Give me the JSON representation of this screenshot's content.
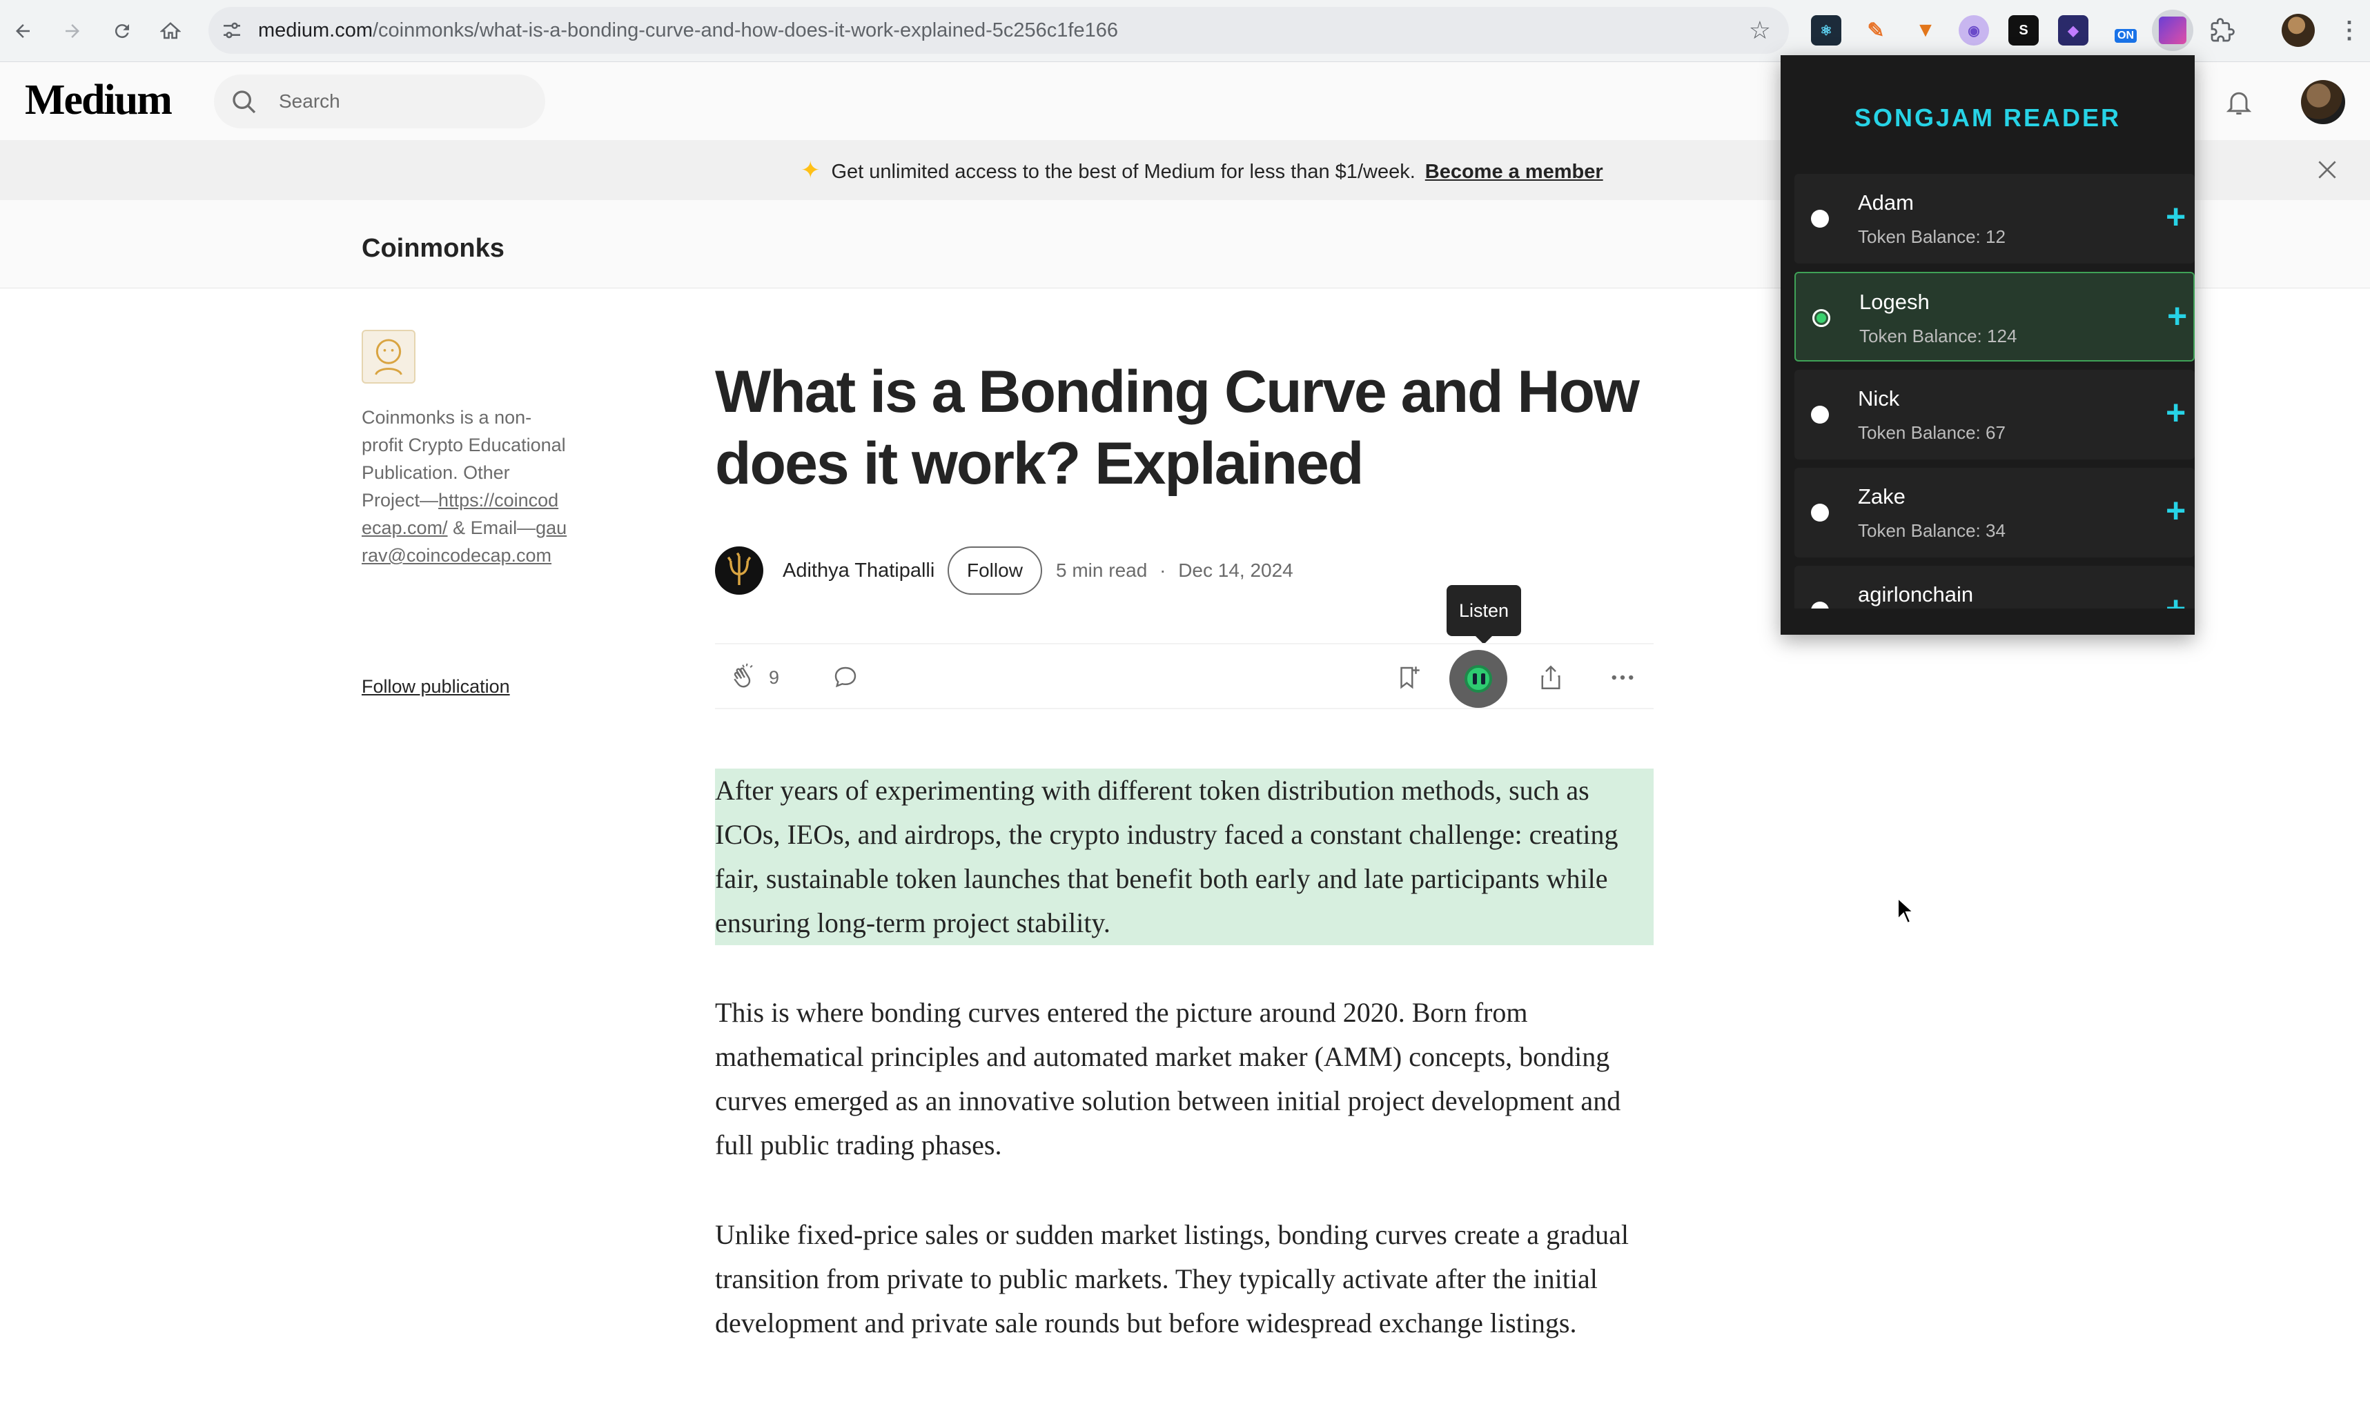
{
  "browser": {
    "url_domain": "medium.com",
    "url_path": "/coinmonks/what-is-a-bonding-curve-and-how-does-it-work-explained-5c256c1fe166",
    "extension_badge": "ON"
  },
  "medium": {
    "logo": "Medium",
    "search_placeholder": "Search"
  },
  "banner": {
    "text": "Get unlimited access to the best of Medium for less than $1/week.",
    "cta": "Become a member"
  },
  "publication": {
    "name": "Coinmonks",
    "description_prefix": "Coinmonks is a non-profit Crypto Educational Publication. Other Project—",
    "project_link": "https://coincodecap.com/",
    "email_label": "& Email—",
    "email": "gaurav@coincodecap.com",
    "follow": "Follow publication"
  },
  "article": {
    "title": "What is a Bonding Curve and How does it work? Explained",
    "author": "Adithya Thatipalli",
    "follow": "Follow",
    "read_time": "5 min read",
    "separator": "·",
    "date": "Dec 14, 2024",
    "claps": "9",
    "listen_tooltip": "Listen",
    "paragraphs": [
      "After years of experimenting with different token distribution methods, such as ICOs, IEOs, and airdrops, the crypto industry faced a constant challenge: creating fair, sustainable token launches that benefit both early and late participants while ensuring long-term project stability.",
      "This is where bonding curves entered the picture around 2020. Born from mathematical principles and automated market maker (AMM) concepts, bonding curves emerged as an innovative solution between initial project development and full public trading phases.",
      "Unlike fixed-price sales or sudden market listings, bonding curves create a gradual transition from private to public markets. They typically activate after the initial development and private sale rounds but before widespread exchange listings."
    ]
  },
  "popup": {
    "title": "SONGJAM READER",
    "balance_label": "Token Balance:",
    "items": [
      {
        "name": "Adam",
        "balance": "12",
        "selected": false
      },
      {
        "name": "Logesh",
        "balance": "124",
        "selected": true
      },
      {
        "name": "Nick",
        "balance": "67",
        "selected": false
      },
      {
        "name": "Zake",
        "balance": "34",
        "selected": false
      },
      {
        "name": "agirlonchain",
        "balance": "",
        "selected": false
      }
    ]
  },
  "colors": {
    "accent_cyan": "#27d3e6",
    "highlight_green": "#d7efdf",
    "selected_green": "#3bd16f",
    "banner_spark": "#ffc017"
  }
}
